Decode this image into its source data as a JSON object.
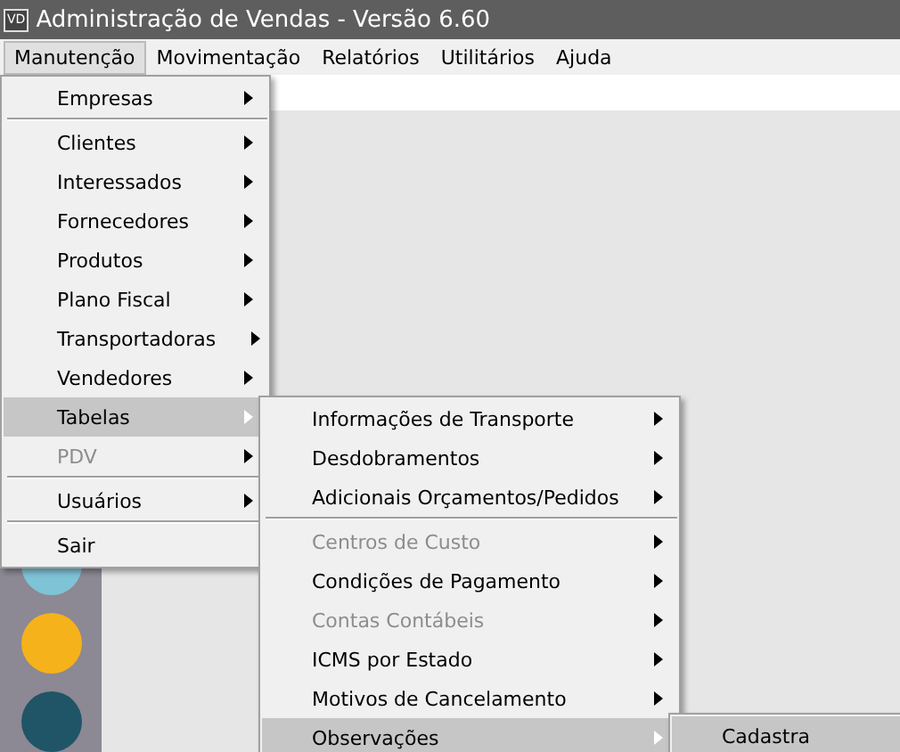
{
  "window": {
    "icon_text": "VD",
    "title": "Administração de Vendas - Versão 6.60"
  },
  "menu_bar": [
    {
      "label": "Manutenção",
      "selected": true
    },
    {
      "label": "Movimentação",
      "selected": false
    },
    {
      "label": "Relatórios",
      "selected": false
    },
    {
      "label": "Utilitários",
      "selected": false
    },
    {
      "label": "Ajuda",
      "selected": false
    }
  ],
  "menus": [
    {
      "items": [
        {
          "kind": "item",
          "label": "Empresas",
          "selected": false,
          "disabled": false,
          "submenu": true
        },
        {
          "kind": "separator"
        },
        {
          "kind": "item",
          "label": "Clientes",
          "selected": false,
          "disabled": false,
          "submenu": true
        },
        {
          "kind": "item",
          "label": "Interessados",
          "selected": false,
          "disabled": false,
          "submenu": true
        },
        {
          "kind": "item",
          "label": "Fornecedores",
          "selected": false,
          "disabled": false,
          "submenu": true
        },
        {
          "kind": "item",
          "label": "Produtos",
          "selected": false,
          "disabled": false,
          "submenu": true
        },
        {
          "kind": "item",
          "label": "Plano Fiscal",
          "selected": false,
          "disabled": false,
          "submenu": true
        },
        {
          "kind": "item",
          "label": "Transportadoras",
          "selected": false,
          "disabled": false,
          "submenu": true
        },
        {
          "kind": "item",
          "label": "Vendedores",
          "selected": false,
          "disabled": false,
          "submenu": true
        },
        {
          "kind": "item",
          "label": "Tabelas",
          "selected": true,
          "disabled": false,
          "submenu": true
        },
        {
          "kind": "item",
          "label": "PDV",
          "selected": false,
          "disabled": true,
          "submenu": true
        },
        {
          "kind": "separator"
        },
        {
          "kind": "item",
          "label": "Usuários",
          "selected": false,
          "disabled": false,
          "submenu": true
        },
        {
          "kind": "separator"
        },
        {
          "kind": "item",
          "label": "Sair",
          "selected": false,
          "disabled": false,
          "submenu": false
        }
      ]
    },
    {
      "items": [
        {
          "kind": "item",
          "label": "Informações de Transporte",
          "selected": false,
          "disabled": false,
          "submenu": true
        },
        {
          "kind": "item",
          "label": "Desdobramentos",
          "selected": false,
          "disabled": false,
          "submenu": true
        },
        {
          "kind": "item",
          "label": "Adicionais Orçamentos/Pedidos",
          "selected": false,
          "disabled": false,
          "submenu": true
        },
        {
          "kind": "separator"
        },
        {
          "kind": "item",
          "label": "Centros de Custo",
          "selected": false,
          "disabled": true,
          "submenu": true
        },
        {
          "kind": "item",
          "label": "Condições de Pagamento",
          "selected": false,
          "disabled": false,
          "submenu": true
        },
        {
          "kind": "item",
          "label": "Contas Contábeis",
          "selected": false,
          "disabled": true,
          "submenu": true
        },
        {
          "kind": "item",
          "label": "ICMS por Estado",
          "selected": false,
          "disabled": false,
          "submenu": true
        },
        {
          "kind": "item",
          "label": "Motivos de Cancelamento",
          "selected": false,
          "disabled": false,
          "submenu": true
        },
        {
          "kind": "item",
          "label": "Observações",
          "selected": true,
          "disabled": false,
          "submenu": true
        }
      ]
    },
    {
      "items": [
        {
          "kind": "item",
          "label": "Cadastra",
          "selected": true,
          "disabled": false,
          "submenu": false
        }
      ]
    }
  ]
}
